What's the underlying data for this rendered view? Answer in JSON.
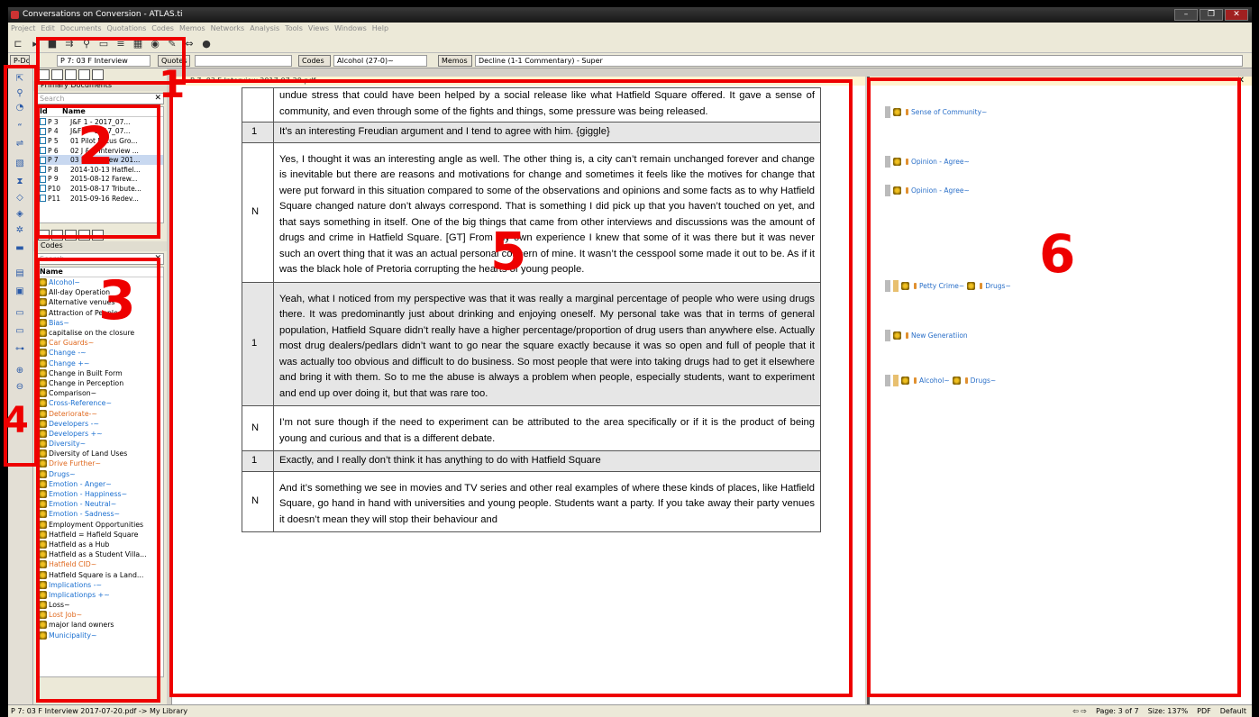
{
  "window": {
    "title": "Conversations on Conversion - ATLAS.ti",
    "controls": [
      "–",
      "❐",
      "✕"
    ]
  },
  "menu": [
    "Project",
    "Edit",
    "Documents",
    "Quotations",
    "Codes",
    "Memos",
    "Networks",
    "Analysis",
    "Tools",
    "Views",
    "Windows",
    "Help"
  ],
  "toolbar2": {
    "pd_label": "P-Docs",
    "pd_selected": "P 7: 03 F Interview",
    "quotes_button": "Quotes",
    "codes_button": "Codes",
    "codes_selected": "Alcohol (27-0)~",
    "memos_button": "Memos",
    "memos_selected": "Decline (1-1 Commentary) - Super"
  },
  "left_panel": {
    "primary_docs_label": "Primary Documents",
    "search_placeholder": "Search",
    "pd_columns": [
      "Id",
      "Name"
    ],
    "documents": [
      {
        "id": "P 3",
        "name": "J&F 1 - 2017_07..."
      },
      {
        "id": "P 4",
        "name": "J&F 2 - 2017_07..."
      },
      {
        "id": "P 5",
        "name": "01 Pilot Focus Gro..."
      },
      {
        "id": "P 6",
        "name": "02 J & F Interview ..."
      },
      {
        "id": "P 7",
        "name": "03 F Interview 201..."
      },
      {
        "id": "P 8",
        "name": "2014-10-13 Hatfiel..."
      },
      {
        "id": "P 9",
        "name": "2015-08-12 Farew..."
      },
      {
        "id": "P10",
        "name": "2015-08-17 Tribute..."
      },
      {
        "id": "P11",
        "name": "2015-09-16 Redev..."
      }
    ],
    "codes_label": "Codes",
    "codes_search_placeholder": "Search",
    "codes_column": "Name",
    "codes": [
      {
        "name": "Alcohol~",
        "color": "#1a6fd0"
      },
      {
        "name": "All-day Operation",
        "color": "#000000"
      },
      {
        "name": "Alternative venues",
        "color": "#000000"
      },
      {
        "name": "Attraction of People",
        "color": "#000000"
      },
      {
        "name": "Bias~",
        "color": "#1a6fd0"
      },
      {
        "name": "capitalise on the closure",
        "color": "#000000"
      },
      {
        "name": "Car Guards~",
        "color": "#e06a20"
      },
      {
        "name": "Change -~",
        "color": "#1a6fd0"
      },
      {
        "name": "Change +~",
        "color": "#1a6fd0"
      },
      {
        "name": "Change in Built Form",
        "color": "#000000"
      },
      {
        "name": "Change in Perception",
        "color": "#000000"
      },
      {
        "name": "Comparison~",
        "color": "#000000"
      },
      {
        "name": "Cross-Reference~",
        "color": "#1a6fd0"
      },
      {
        "name": "Deteriorate-~",
        "color": "#e06a20"
      },
      {
        "name": "Developers -~",
        "color": "#1a6fd0"
      },
      {
        "name": "Developers +~",
        "color": "#1a6fd0"
      },
      {
        "name": "Diversity~",
        "color": "#1a6fd0"
      },
      {
        "name": "Diversity of Land Uses",
        "color": "#000000"
      },
      {
        "name": "Drive Further~",
        "color": "#e06a20"
      },
      {
        "name": "Drugs~",
        "color": "#1a6fd0"
      },
      {
        "name": "Emotion - Anger~",
        "color": "#1a6fd0"
      },
      {
        "name": "Emotion - Happiness~",
        "color": "#1a6fd0"
      },
      {
        "name": "Emotion - Neutral~",
        "color": "#1a6fd0"
      },
      {
        "name": "Emotion - Sadness~",
        "color": "#1a6fd0"
      },
      {
        "name": "Employment Opportunities",
        "color": "#000000"
      },
      {
        "name": "Hatfield = Hafield Square",
        "color": "#000000"
      },
      {
        "name": "Hatfield as a Hub",
        "color": "#000000"
      },
      {
        "name": "Hatfield as a Student Villa...",
        "color": "#000000"
      },
      {
        "name": "Hatfield CID~",
        "color": "#e06a20"
      },
      {
        "name": "Hatfield Square is a Land...",
        "color": "#000000"
      },
      {
        "name": "Implications -~",
        "color": "#1a6fd0"
      },
      {
        "name": "Implicationps +~",
        "color": "#1a6fd0"
      },
      {
        "name": "Loss~",
        "color": "#000000"
      },
      {
        "name": "Lost Job~",
        "color": "#e06a20"
      },
      {
        "name": "major land owners",
        "color": "#000000"
      },
      {
        "name": "Municipality~",
        "color": "#1a6fd0"
      }
    ]
  },
  "document": {
    "tab_title": "P 7: 03 F Interview 2017-07-20.pdf",
    "rows": [
      {
        "speaker": "",
        "text": "undue stress that could have been helped by a social release like what Hatfield Square offered. It gave a sense of community, and even through some of the fights and things, some pressure was being released.",
        "shade": false
      },
      {
        "speaker": "1",
        "text": "It’s an interesting Freudian argument and I tend to agree with him. {giggle}",
        "shade": true
      },
      {
        "speaker": "N",
        "text": "Yes, I thought it was an interesting angle as well. The other thing is, a city can’t remain unchanged forever and change is inevitable but there are reasons and motivations for change and sometimes it feels like the motives for change that were put forward in this situation compared to some of the observations and opinions and some facts as to why Hatfield Square changed nature don’t always correspond. That is something I did pick up that you haven’t touched on yet, and that says something in itself. One of the big things that came from other interviews and discussions was the amount of drugs and crime in Hatfield Square. [GT] From my own experience I knew that some of it was there but it was never such an overt thing that it was an actual personal concern of mine. It wasn’t the cesspool some made it out to be. As if it was the black hole of Pretoria corrupting the hearts of young people.",
        "shade": false
      },
      {
        "speaker": "1",
        "text": "Yeah, what I noticed from my perspective was that it was really a marginal percentage of people who were using drugs there. It was predominantly just about drinking and enjoying oneself. My personal take was that in terms of general population, Hatfield Square didn’t really have a higher percentage/proportion of drug users than anywhere else. Actually most drug dealers/pedlars didn’t want to go near the square exactly because it was so open and full of people that it was actually too obvious and difficult to do business. So most people that were into taking drugs had to get it elsewhere and bring it with them. So to me the abuse is always a problem when people, especially students, want to experiment and end up over doing it, but that was rare too.",
        "shade": true
      },
      {
        "speaker": "N",
        "text": "I’m not sure though if the need to experiment can be attributed to the area specifically or if it is the product of being young and curious and that is a different debate.",
        "shade": false
      },
      {
        "speaker": "1",
        "text": "Exactly, and I really don’t think it has anything to do with Hatfield Square",
        "shade": true
      },
      {
        "speaker": "N",
        "text": "And it’s something we see in movies and TV series and other real examples of where these kinds of places, like Hatfield Square, go hand in hand with universities and young people. Students want a party. If you take away their party venues it doesn’t mean they will stop their behaviour and",
        "shade": false
      }
    ]
  },
  "margin": {
    "codes": [
      {
        "labels": [
          "Sense of Community~"
        ]
      },
      {
        "labels": [
          "Opinion - Agree~"
        ]
      },
      {
        "labels": [
          "Opinion - Agree~"
        ]
      },
      {
        "labels": [
          "Petty Crime~",
          "Drugs~"
        ]
      },
      {
        "labels": [
          "New Generatiion"
        ]
      },
      {
        "labels": [
          "Alcohol~",
          "Drugs~"
        ]
      }
    ]
  },
  "statusbar": {
    "left": "P 7: 03 F Interview 2017-07-20.pdf -> My Library",
    "page": "Page: 3 of 7",
    "size": "Size: 137%",
    "type": "PDF",
    "mode": "Default"
  },
  "annotations": [
    "1",
    "2",
    "3",
    "4",
    "5",
    "6"
  ],
  "colors": {
    "annotation": "#e00000",
    "code_link": "#2a6fc8",
    "shade": "#e6e6e6"
  }
}
